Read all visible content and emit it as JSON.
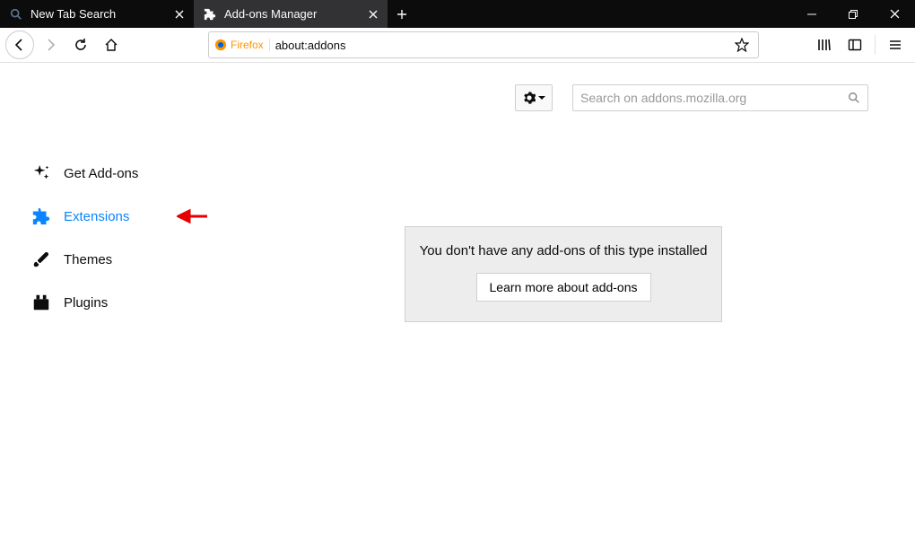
{
  "tabs": [
    {
      "title": "New Tab Search",
      "active": false
    },
    {
      "title": "Add-ons Manager",
      "active": true
    }
  ],
  "addressbar": {
    "identity": "Firefox",
    "url": "about:addons"
  },
  "sidebar": {
    "items": [
      {
        "label": "Get Add-ons"
      },
      {
        "label": "Extensions"
      },
      {
        "label": "Themes"
      },
      {
        "label": "Plugins"
      }
    ]
  },
  "search": {
    "placeholder": "Search on addons.mozilla.org"
  },
  "empty": {
    "message": "You don't have any add-ons of this type installed",
    "button": "Learn more about add-ons"
  }
}
